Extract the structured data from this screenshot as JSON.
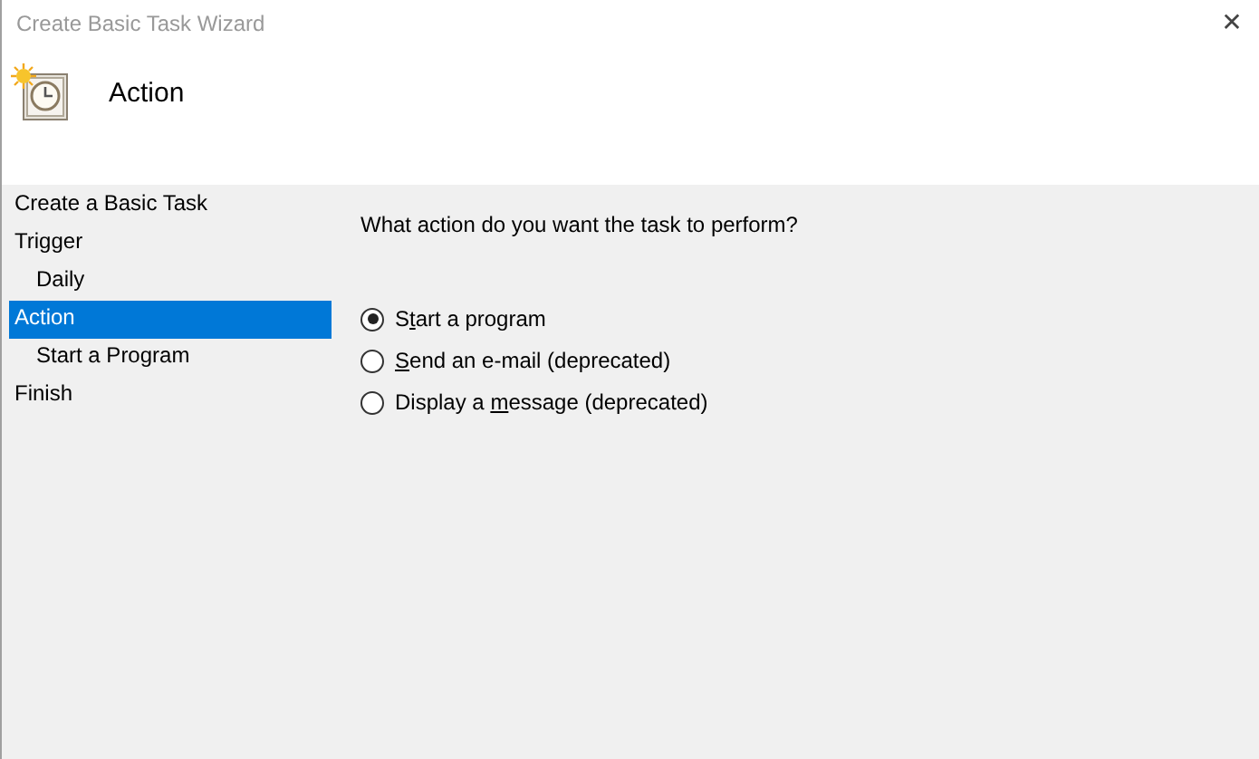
{
  "window": {
    "title": "Create Basic Task Wizard",
    "close": "✕"
  },
  "header": {
    "title": "Action"
  },
  "steps": [
    {
      "label": "Create a Basic Task",
      "selected": false
    },
    {
      "label": "Trigger",
      "selected": false,
      "children": [
        {
          "label": "Daily",
          "selected": false
        }
      ]
    },
    {
      "label": "Action",
      "selected": true,
      "children": [
        {
          "label": "Start a Program",
          "selected": false
        }
      ]
    },
    {
      "label": "Finish",
      "selected": false
    }
  ],
  "question": "What action do you want the task to perform?",
  "options": [
    {
      "before": "S",
      "key": "t",
      "after": "art a program",
      "selected": true
    },
    {
      "key": "S",
      "after": "end an e-mail (deprecated)",
      "selected": false
    },
    {
      "before": "Display a ",
      "key": "m",
      "after": "essage (deprecated)",
      "selected": false
    }
  ]
}
